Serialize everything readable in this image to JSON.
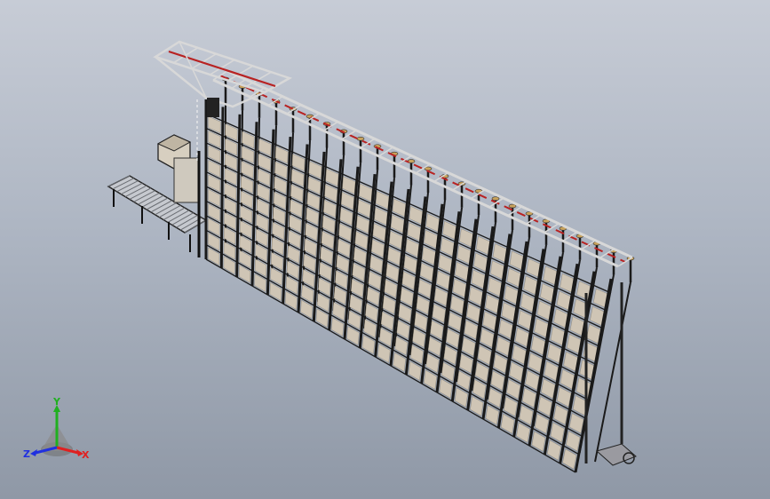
{
  "view": {
    "background_top": "#c7ccd6",
    "background_bottom": "#8f98a6"
  },
  "model": {
    "rack_columns": 24,
    "rack_levels": 10,
    "frame_color": "#1a1a1a",
    "bin_color": "#cfc5b5",
    "rail_color": "#b82222",
    "post_cap_color": "#c8a25c",
    "crane_color": "#d8d8d8"
  },
  "triad": {
    "x_label": "X",
    "y_label": "Y",
    "z_label": "Z",
    "x_color": "#e02020",
    "y_color": "#20b020",
    "z_color": "#2030e0"
  }
}
